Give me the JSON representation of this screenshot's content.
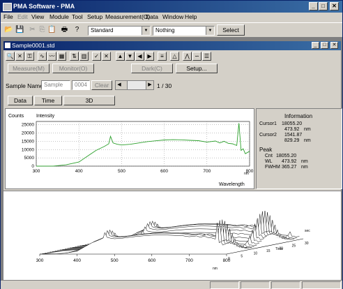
{
  "app": {
    "title": "PMA Software - PMA"
  },
  "menu": [
    "File",
    "Edit",
    "View",
    "Module",
    "Tool",
    "Setup",
    "Measurement(O)",
    "Data",
    "Window",
    "Help"
  ],
  "toolbar": {
    "preset_combo": "Standard",
    "nothing_combo": "Nothing",
    "select_button": "Select"
  },
  "child": {
    "title": "Sample0001.std",
    "buttons": {
      "measure": "Measure(M)",
      "monitor": "Monitor(O)",
      "dark": "Dark(C)",
      "setup": "Setup..."
    },
    "sample_name_label": "Sample Name",
    "sample_name_value": "Sample",
    "sample_index": "0004",
    "clear_button": "Clear",
    "page_indicator": "1 / 30",
    "tabs": [
      "Data",
      "Time",
      "3D"
    ]
  },
  "graph": {
    "counts_label": "Counts",
    "intensity_label": "Intensity",
    "y_ticks": [
      "25000",
      "20000",
      "15000",
      "10000",
      "5000",
      "0"
    ],
    "x_ticks": [
      "300",
      "400",
      "500",
      "600",
      "700",
      "800"
    ],
    "x_unit": "nm",
    "xlabel": "Wavelength"
  },
  "info": {
    "title": "Information",
    "cursor1_label": "Cursor1",
    "cursor1_value": "18055.20",
    "cursor1_nm": "473.92",
    "cursor2_label": "Cursor2",
    "cursor2_value": "1541.87",
    "cursor2_nm": "829.29",
    "nm": "nm",
    "peak_label": "Peak",
    "cnt_label": "Cnt",
    "cnt_value": "18055.20",
    "wl_label": "WL",
    "wl_value": "473.92",
    "fwhm_label": "FWHM",
    "fwhm_value": "365.27",
    "fwhm_unit": "nm"
  },
  "graph3d": {
    "x_ticks": [
      "300",
      "400",
      "500",
      "600",
      "700",
      "800"
    ],
    "x_unit": "nm",
    "time_ticks": [
      "0",
      "5",
      "10",
      "15",
      "20",
      "25",
      "30"
    ],
    "time_label": "Time",
    "time_unit": "sec"
  },
  "chart_data": {
    "type": "line",
    "xlabel": "Wavelength",
    "ylabel": "Counts",
    "xlim": [
      300,
      800
    ],
    "ylim": [
      0,
      27000
    ],
    "series": [
      {
        "name": "Intensity",
        "x": [
          300,
          340,
          370,
          400,
          420,
          440,
          460,
          470,
          474,
          480,
          490,
          500,
          520,
          540,
          560,
          580,
          600,
          620,
          640,
          660,
          680,
          700,
          720,
          730,
          740,
          750,
          760,
          770,
          775,
          780,
          785,
          790,
          800
        ],
        "y": [
          0,
          50,
          800,
          2500,
          6000,
          9500,
          12000,
          13500,
          18000,
          14000,
          13200,
          12800,
          13200,
          14000,
          14800,
          15300,
          15800,
          16000,
          15900,
          15600,
          15400,
          14500,
          15200,
          14000,
          15000,
          13800,
          13500,
          12500,
          26000,
          9500,
          10500,
          7500,
          9000
        ]
      }
    ]
  }
}
